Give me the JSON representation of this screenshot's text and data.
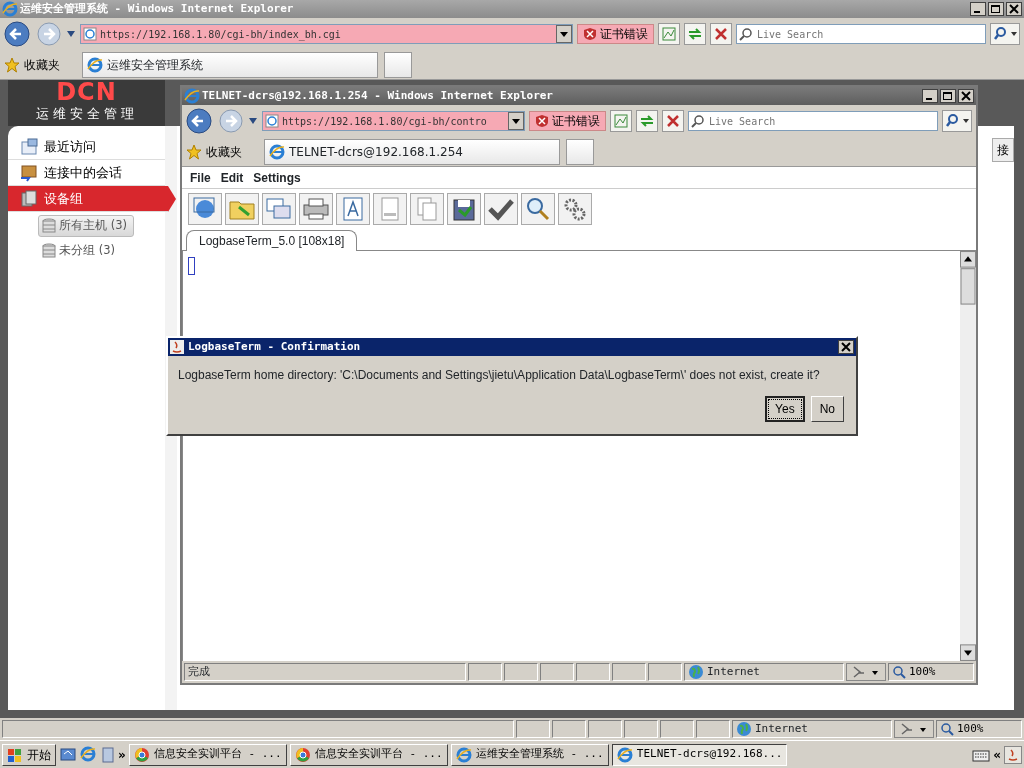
{
  "outer_window": {
    "title": "运维安全管理系统 - Windows Internet Explorer",
    "address": "https://192.168.1.80/cgi-bh/index_bh.cgi",
    "cert_error": "证书错误",
    "search_placeholder": "Live Search",
    "favorites": "收藏夹",
    "tab_title": "运维安全管理系统",
    "status": {
      "zone": "Internet",
      "zoom": "100%"
    }
  },
  "app": {
    "logo": "DCN",
    "subtitle": "运维安全管理",
    "nav": [
      {
        "label": "最近访问",
        "selected": false
      },
      {
        "label": "连接中的会话",
        "selected": false
      },
      {
        "label": "设备组",
        "selected": true
      }
    ],
    "groups": [
      {
        "label": "所有主机 (3)",
        "selected": true
      },
      {
        "label": "未分组 (3)",
        "selected": false
      }
    ],
    "partial_button": "接"
  },
  "inner_window": {
    "title": "TELNET-dcrs@192.168.1.254 - Windows Internet Explorer",
    "address": "https://192.168.1.80/cgi-bh/contro",
    "cert_error": "证书错误",
    "search_placeholder": "Live Search",
    "favorites": "收藏夹",
    "tab_title": "TELNET-dcrs@192.168.1.254",
    "menu": [
      "File",
      "Edit",
      "Settings"
    ],
    "terminal_tab": "LogbaseTerm_5.0 [108x18]",
    "status": {
      "text": "完成",
      "zone": "Internet",
      "zoom": "100%"
    }
  },
  "dialog": {
    "title": "LogbaseTerm - Confirmation",
    "message": "LogbaseTerm home directory: 'C:\\Documents and Settings\\jietu\\Application Data\\LogbaseTerm\\' does not exist, create it?",
    "buttons": [
      {
        "label": "Yes",
        "selected": true
      },
      {
        "label": "No",
        "selected": false
      }
    ]
  },
  "taskbar": {
    "start": "开始",
    "more": "»",
    "tasks": [
      {
        "label": "信息安全实训平台 - ...",
        "kind": "chrome",
        "selected": false
      },
      {
        "label": "信息安全实训平台 - ...",
        "kind": "chrome",
        "selected": false
      },
      {
        "label": "运维安全管理系统 - ...",
        "kind": "ie",
        "selected": false
      },
      {
        "label": "TELNET-dcrs@192.168...",
        "kind": "ie",
        "selected": true
      }
    ],
    "tray_chevron": "«"
  }
}
